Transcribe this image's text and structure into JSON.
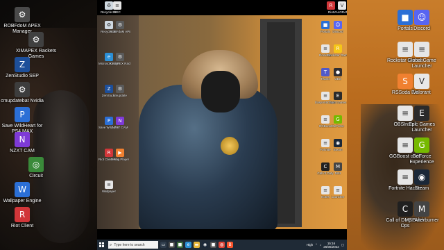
{
  "outer_left_icons": [
    {
      "label": "ROBFdoM APEX Manager",
      "icon": "gear-icon",
      "color": "#4a4a4a"
    },
    {
      "label": "XIMAPEX Rackets Games",
      "icon": "gear-icon",
      "color": "#404040"
    },
    {
      "label": "ZenStudio SEP",
      "icon": "zen-icon",
      "color": "#1d4f9a"
    },
    {
      "label": "cmupdatebat Nvidia",
      "icon": "gear-icon",
      "color": "#3d3d3d"
    },
    {
      "label": "Save WildHeart for PS4 MAX",
      "icon": "p-icon",
      "color": "#2b6fd6"
    },
    {
      "label": "NZXT CAM",
      "icon": "nzxt-icon",
      "color": "#7e3ad6"
    },
    {
      "label": "Circuit",
      "icon": "circuit-icon",
      "color": "#3a8a3a"
    },
    {
      "label": "Wallpaper Engine",
      "icon": "wallpaper-icon",
      "color": "#2b6fd6"
    },
    {
      "label": "Riot Client",
      "icon": "riot-icon",
      "color": "#d13639"
    }
  ],
  "outer_right_icons": [
    {
      "label": "Portals",
      "icon": "app-icon",
      "color": "#2b6fd6"
    },
    {
      "label": "Discord",
      "icon": "discord-icon",
      "color": "#5865f2"
    },
    {
      "label": "Rockstar Games",
      "icon": "doc-icon",
      "color": "#e6e6e6"
    },
    {
      "label": "Global Game Launcher",
      "icon": "doc-icon",
      "color": "#e6e6e6"
    },
    {
      "label": "RSSoda Ext",
      "icon": "rs-icon",
      "color": "#f08030"
    },
    {
      "label": "Valorant",
      "icon": "valorant-icon",
      "color": "#e8e8e8"
    },
    {
      "label": "OBSInstall",
      "icon": "doc-icon",
      "color": "#e6e6e6"
    },
    {
      "label": "Epic Games Launcher",
      "icon": "epic-icon",
      "color": "#2a2a2a"
    },
    {
      "label": "GGBoost code",
      "icon": "doc-icon",
      "color": "#e6e6e6"
    },
    {
      "label": "GeForce Experience",
      "icon": "geforce-icon",
      "color": "#76b900"
    },
    {
      "label": "Fortnite Hacker",
      "icon": "doc-icon",
      "color": "#e6e6e6"
    },
    {
      "label": "Steam",
      "icon": "steam-icon",
      "color": "#1b2838"
    },
    {
      "label": "Call of Duty Black Ops",
      "icon": "cod-icon",
      "color": "#202020"
    },
    {
      "label": "MSI Afterburner",
      "icon": "msi-icon",
      "color": "#444444"
    }
  ],
  "desktop_left_icons": [
    {
      "label": "Recycle Bin",
      "icon": "recycle-icon",
      "color": "#cfd8e0"
    },
    {
      "label": "ROBFdoM APEX Manager",
      "icon": "gear-icon",
      "color": "#5a5a5a"
    },
    {
      "label": "Microsoft Edge",
      "icon": "edge-icon",
      "color": "#2b8fd6"
    },
    {
      "label": "XIMAPEX Rackets",
      "icon": "gear-icon",
      "color": "#5a5a5a"
    },
    {
      "label": "ZenStudio",
      "icon": "zen-icon",
      "color": "#1d4f9a"
    },
    {
      "label": "cmupdate",
      "icon": "gear-icon",
      "color": "#5a5a5a"
    },
    {
      "label": "Save WildHeart for PS4 MAX",
      "icon": "p-icon",
      "color": "#2b6fd6"
    },
    {
      "label": "NZXT CAM",
      "icon": "nzxt-icon",
      "color": "#7e3ad6"
    },
    {
      "label": "Riot Client Engine",
      "icon": "riot-icon",
      "color": "#d13639"
    },
    {
      "label": "Media Player",
      "icon": "media-icon",
      "color": "#f08030"
    },
    {
      "label": "Wallpaper",
      "icon": "doc-icon",
      "color": "#e6e6e6"
    }
  ],
  "desktop_top_icons": [
    {
      "label": "Recycle Bin",
      "icon": "recycle-icon",
      "color": "#cfd8e0"
    },
    {
      "label": "REC",
      "icon": "doc-icon",
      "color": "#e6e6e6"
    },
    {
      "label": "Riot",
      "icon": "riot-icon",
      "color": "#d13639"
    },
    {
      "label": "VALORANT",
      "icon": "valorant-icon",
      "color": "#e8e8e8"
    }
  ],
  "desktop_right_icons": [
    {
      "label": "Portals",
      "icon": "app-icon",
      "color": "#2b6fd6"
    },
    {
      "label": "Discord",
      "icon": "discord-icon",
      "color": "#5865f2"
    },
    {
      "label": "Rockstar",
      "icon": "doc-icon",
      "color": "#e6e6e6"
    },
    {
      "label": "Rockstar Games",
      "icon": "rockstar-icon",
      "color": "#f5c518"
    },
    {
      "label": "Teams",
      "icon": "teams-icon",
      "color": "#5059c9"
    },
    {
      "label": "OBS",
      "icon": "obs-icon",
      "color": "#302e31"
    },
    {
      "label": "EasyAntiCheat",
      "icon": "doc-icon",
      "color": "#e6e6e6"
    },
    {
      "label": "Epic Games",
      "icon": "epic-icon",
      "color": "#2a2a2a"
    },
    {
      "label": "GGBoost",
      "icon": "doc-icon",
      "color": "#e6e6e6"
    },
    {
      "label": "GeForce",
      "icon": "geforce-icon",
      "color": "#76b900"
    },
    {
      "label": "Fortnite",
      "icon": "doc-icon",
      "color": "#e6e6e6"
    },
    {
      "label": "Steam",
      "icon": "steam-icon",
      "color": "#1b2838"
    },
    {
      "label": "Call of Duty",
      "icon": "cod-icon",
      "color": "#202020"
    },
    {
      "label": "MSI",
      "icon": "msi-icon",
      "color": "#444444"
    },
    {
      "label": "Notes",
      "icon": "doc-icon",
      "color": "#e6e6e6"
    },
    {
      "label": "Launcher",
      "icon": "doc-icon",
      "color": "#e6e6e6"
    }
  ],
  "taskbar": {
    "search_placeholder": "Type here to search",
    "pinned": [
      {
        "name": "task-view",
        "icon": "task-view-icon",
        "color": "#2f3d4c"
      },
      {
        "name": "app-1",
        "icon": "app-icon",
        "color": "#4a4a4a"
      },
      {
        "name": "app-2",
        "icon": "app-icon",
        "color": "#3a6b3a"
      },
      {
        "name": "edge",
        "icon": "edge-icon",
        "color": "#2b8fd6"
      },
      {
        "name": "file-explorer",
        "icon": "folder-icon",
        "color": "#e8b63a"
      },
      {
        "name": "steam",
        "icon": "steam-icon",
        "color": "#1b2838"
      },
      {
        "name": "app-3",
        "icon": "app-icon",
        "color": "#555555"
      },
      {
        "name": "chrome",
        "icon": "chrome-icon",
        "color": "#db4437"
      },
      {
        "name": "brave",
        "icon": "brave-icon",
        "color": "#fb542b"
      }
    ],
    "tray_label": "High",
    "time": "15:16",
    "date": "26/06/2022"
  }
}
